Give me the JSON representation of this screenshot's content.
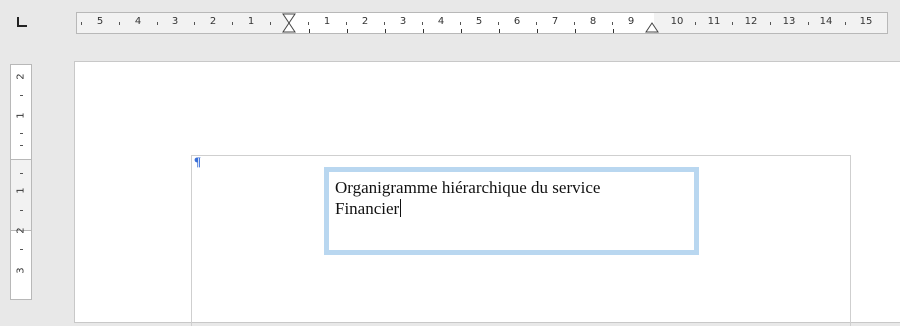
{
  "ruler": {
    "horizontal_numbers": [
      "5",
      "4",
      "3",
      "2",
      "1",
      "1",
      "2",
      "3",
      "4",
      "5",
      "6",
      "7",
      "8",
      "9",
      "10",
      "11",
      "12",
      "13",
      "14",
      "15"
    ],
    "vertical_numbers": [
      "2",
      "1",
      "1",
      "2",
      "3"
    ]
  },
  "document": {
    "pilcrow": "¶",
    "frame_lines": [
      "Organigramme hiérarchique du service",
      "Financier"
    ]
  },
  "colors": {
    "frame_border": "#b9d7f0",
    "pilcrow": "#3a6fd8",
    "background": "#e8e8e8"
  },
  "icons": {
    "tab_selector": "left-tab-icon",
    "first_line_indent": "hourglass-indent-icon",
    "right_indent": "triangle-indent-icon"
  }
}
